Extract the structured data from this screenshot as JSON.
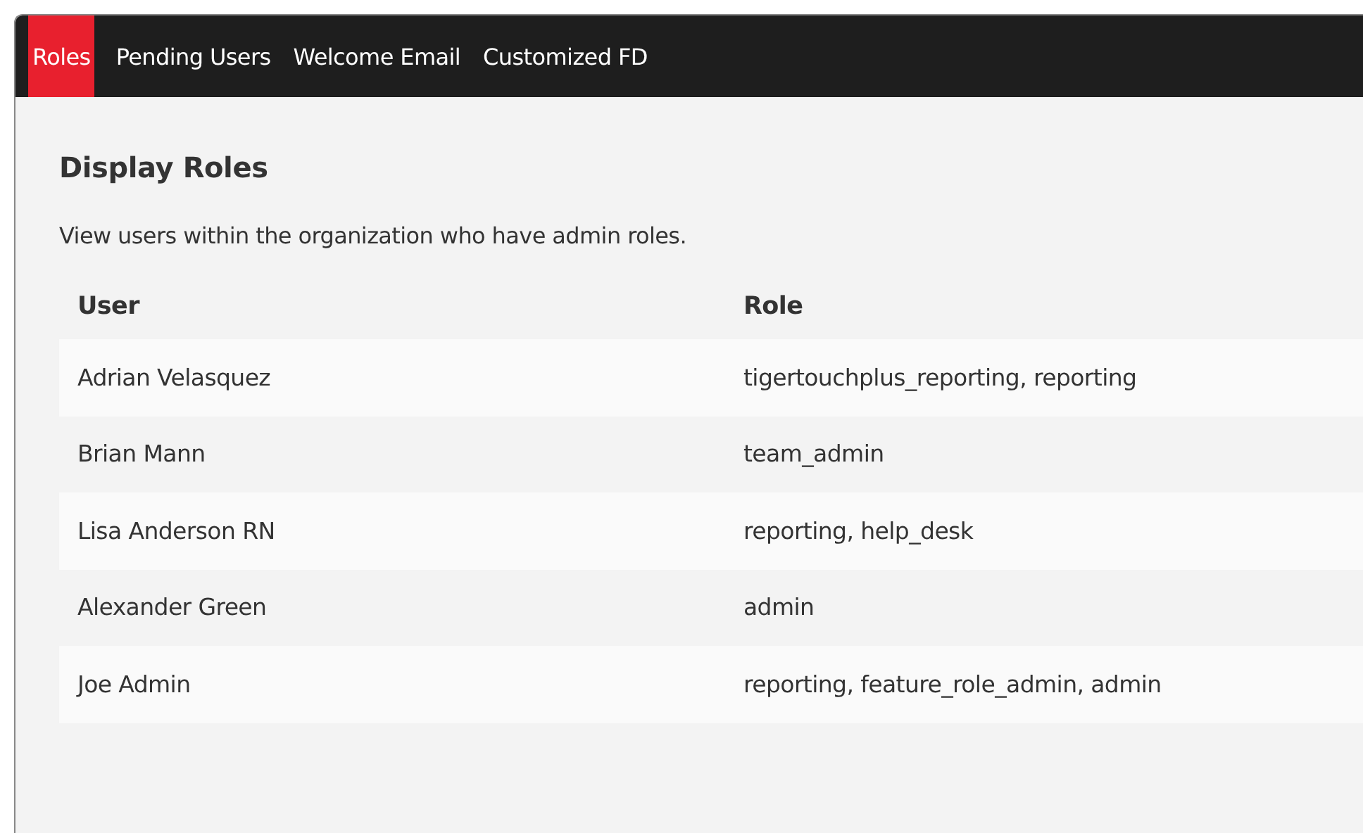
{
  "tabs": [
    {
      "label": "Roles",
      "selected": true
    },
    {
      "label": "Pending Users",
      "selected": false
    },
    {
      "label": "Welcome Email",
      "selected": false
    },
    {
      "label": "Customized FD",
      "selected": false
    }
  ],
  "heading": "Display Roles",
  "description": "View users within the organization who have admin roles.",
  "table": {
    "columns": [
      "User",
      "Role"
    ],
    "rows": [
      [
        "Adrian Velasquez",
        "tigertouchplus_reporting, reporting"
      ],
      [
        "Brian Mann",
        "team_admin"
      ],
      [
        "Lisa Anderson RN",
        "reporting, help_desk"
      ],
      [
        "Alexander Green",
        "admin"
      ],
      [
        "Joe Admin",
        "reporting, feature_role_admin, admin"
      ]
    ]
  }
}
